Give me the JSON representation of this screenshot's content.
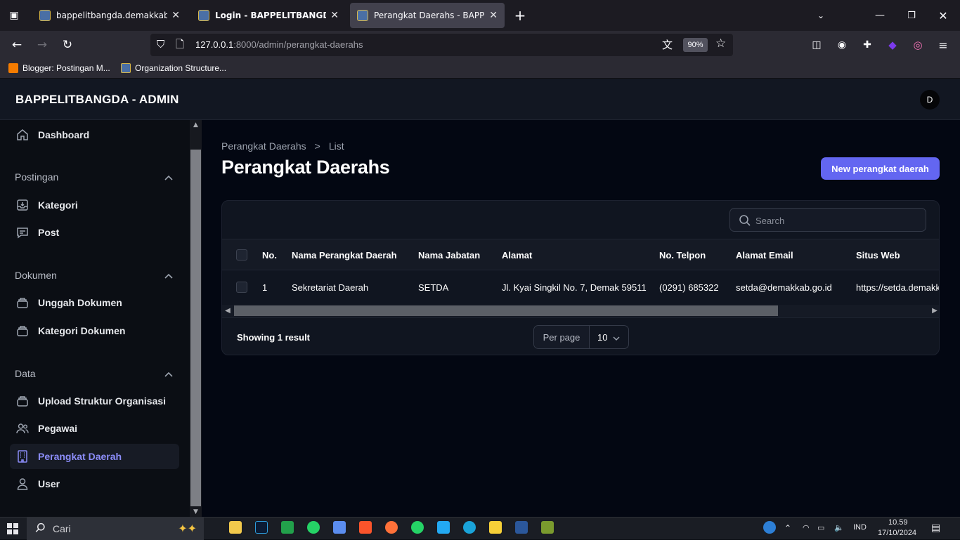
{
  "browser": {
    "tabs": [
      {
        "title": "bappelitbangda.demakkab",
        "active": false
      },
      {
        "title": "Login - BAPPELITBANGDA - AI",
        "active": false
      },
      {
        "title": "Perangkat Daerahs - BAPPELITB",
        "active": true
      }
    ],
    "new_tab": "+",
    "url_host": "127.0.0.1",
    "url_path": ":8000/admin/perangkat-daerahs",
    "zoom": "90%",
    "bookmarks": [
      {
        "label": "Blogger: Postingan M...",
        "color": "#f57c00"
      },
      {
        "label": "Organization Structure...",
        "color": "#4a6fa5"
      }
    ]
  },
  "app": {
    "brand": "BAPPELITBANGDA - ADMIN",
    "avatar_initial": "D"
  },
  "sidebar": {
    "dashboard": "Dashboard",
    "groups": [
      {
        "label": "Postingan",
        "items": [
          "Kategori",
          "Post"
        ]
      },
      {
        "label": "Dokumen",
        "items": [
          "Unggah Dokumen",
          "Kategori Dokumen"
        ]
      },
      {
        "label": "Data",
        "items": [
          "Upload Struktur Organisasi",
          "Pegawai",
          "Perangkat Daerah",
          "User"
        ]
      }
    ],
    "active_item": "Perangkat Daerah"
  },
  "page": {
    "breadcrumb": [
      "Perangkat Daerahs",
      "List"
    ],
    "breadcrumb_sep": ">",
    "title": "Perangkat Daerahs",
    "new_button": "New perangkat daerah",
    "search_placeholder": "Search"
  },
  "table": {
    "columns": [
      "No.",
      "Nama Perangkat Daerah",
      "Nama Jabatan",
      "Alamat",
      "No. Telpon",
      "Alamat Email",
      "Situs Web"
    ],
    "rows": [
      [
        "1",
        "Sekretariat Daerah",
        "SETDA",
        "Jl. Kyai Singkil No. 7, Demak 59511",
        "(0291) 685322",
        "setda@demakkab.go.id",
        "https://setda.demakkab.go.id"
      ]
    ],
    "showing": "Showing 1 result",
    "per_page_label": "Per page",
    "per_page_value": "10"
  },
  "taskbar": {
    "search_label": "Cari",
    "lang": "IND",
    "time": "10.59",
    "date": "17/10/2024"
  },
  "colors": {
    "accent": "#6366f1",
    "active_nav_text": "#8b8cf8"
  }
}
